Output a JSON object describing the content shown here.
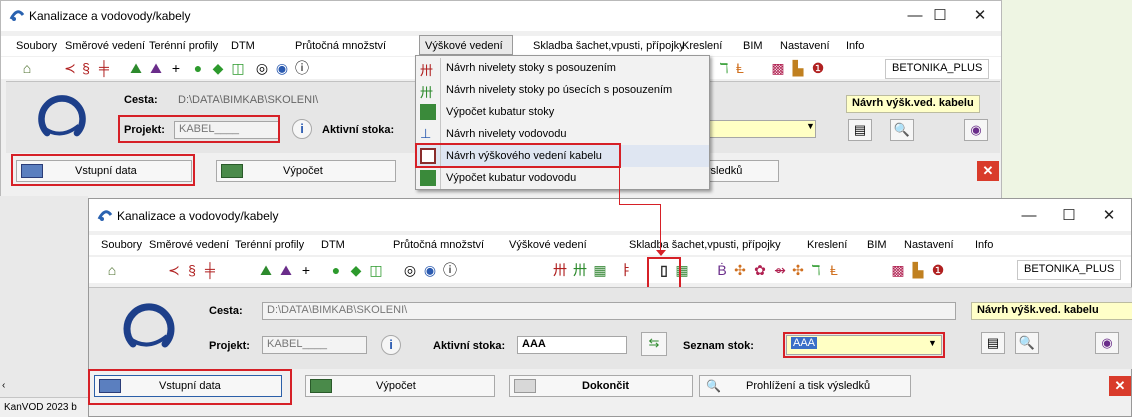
{
  "app": {
    "title": "Kanalizace a vodovody/kabely",
    "menu": [
      "Soubory",
      "Směrové vedení",
      "Terénní profily",
      "DTM",
      "Průtočná množství",
      "Výškové vedení",
      "Skladba šachet,vpusti, přípojky",
      "Kreslení",
      "BIM",
      "Nastavení",
      "Info"
    ],
    "betonika_label": "BETONIKA_PLUS",
    "window_controls": {
      "minimize": "—",
      "maximize": "☐",
      "close": "✕"
    }
  },
  "form": {
    "cesta_label": "Cesta:",
    "cesta_value": "D:\\DATA\\BIMKAB\\SKOLENI\\",
    "projekt_label": "Projekt:",
    "projekt_value": "KABEL____",
    "aktivni_label": "Aktivní stoka:",
    "aktivni_value": "AAA",
    "seznam_label": "Seznam stok:",
    "seznam_value": "AAA",
    "mode_badge": "Návrh výšk.ved. kabelu",
    "info_icon": "i"
  },
  "buttons": {
    "vstupni": "Vstupní data",
    "vypocet": "Výpočet",
    "dokoncit": "Dokončit",
    "prohlizeni": "Prohlížení a tisk výsledků",
    "prohlizeni_partial": "tisk výsledků"
  },
  "dropdown": {
    "items": [
      "Návrh nivelety stoky s posouzením",
      "Návrh nivelety stoky po úsecích s posouzením",
      "Výpočet kubatur stoky",
      "Návrh nivelety vodovodu",
      "Návrh výškového vedení kabelu",
      "Výpočet kubatur vodovodu"
    ],
    "highlighted_index": 4
  },
  "statusbar": {
    "text": "KanVOD 2023 b"
  },
  "colors": {
    "highlight_red": "#d62027",
    "yellow_field": "#ffffc4",
    "logo_blue": "#1d3f8a",
    "close_red": "#d93b2b"
  }
}
